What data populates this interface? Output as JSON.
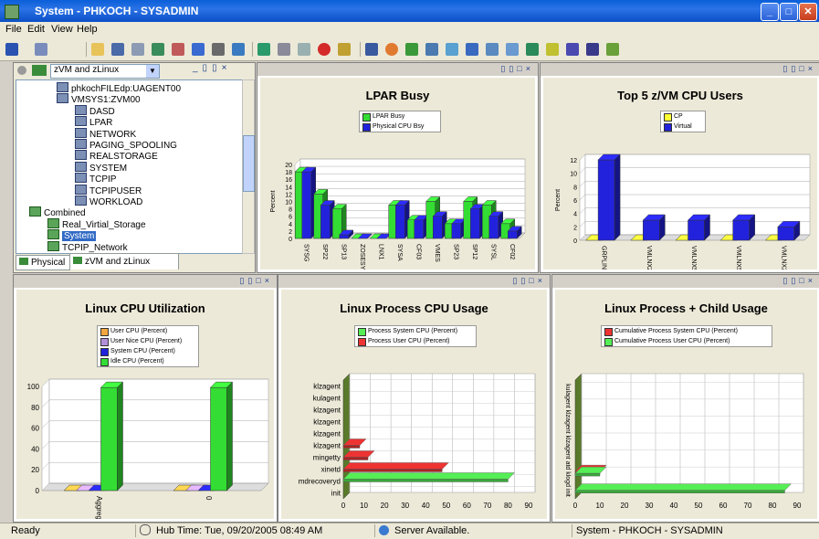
{
  "window": {
    "title": "System - PHKOCH - SYSADMIN",
    "colors": {
      "titlebar": "#0a5fd8",
      "panel_bg": "#ece9d8",
      "green": "#33dd33",
      "blue": "#2222dd",
      "red": "#ee3333",
      "orange": "#f4a640",
      "purple": "#b28fd8",
      "yellow": "#ffff33",
      "light_green": "#55ee55"
    }
  },
  "menu": [
    "File",
    "Edit",
    "View",
    "Help"
  ],
  "navigator": {
    "view_select": "zVM and zLinux",
    "tree": [
      {
        "label": "phkochFILEdp:UAGENT00",
        "level": 4,
        "icon": "node-icon"
      },
      {
        "label": "VMSYS1:ZVM00",
        "level": 4,
        "icon": "node-icon"
      },
      {
        "label": "DASD",
        "level": 6,
        "icon": "workspace-icon"
      },
      {
        "label": "LPAR",
        "level": 6,
        "icon": "workspace-icon"
      },
      {
        "label": "NETWORK",
        "level": 6,
        "icon": "workspace-icon"
      },
      {
        "label": "PAGING_SPOOLING",
        "level": 6,
        "icon": "workspace-icon"
      },
      {
        "label": "REALSTORAGE",
        "level": 6,
        "icon": "workspace-icon"
      },
      {
        "label": "SYSTEM",
        "level": 6,
        "icon": "workspace-icon"
      },
      {
        "label": "TCPIP",
        "level": 6,
        "icon": "workspace-icon"
      },
      {
        "label": "TCPIPUSER",
        "level": 6,
        "icon": "workspace-icon"
      },
      {
        "label": "WORKLOAD",
        "level": 6,
        "icon": "workspace-icon"
      },
      {
        "label": "Combined",
        "level": 1,
        "icon": "combined-icon"
      },
      {
        "label": "Real_Virtial_Storage",
        "level": 3,
        "icon": "combined-icon"
      },
      {
        "label": "System",
        "level": 3,
        "icon": "combined-icon",
        "selected": true
      },
      {
        "label": "TCPIP_Network",
        "level": 3,
        "icon": "combined-icon"
      }
    ],
    "tabs": [
      "Physical",
      "zVM and zLinux"
    ]
  },
  "charts": {
    "lpar": {
      "title": "LPAR Busy",
      "ylabel": "Percent",
      "yticks": [
        "0",
        "2",
        "4",
        "6",
        "8",
        "10",
        "12",
        "14",
        "16",
        "18",
        "20"
      ],
      "ymax": 20,
      "legend": [
        "LPAR Busy",
        "Physical CPU Bsy"
      ],
      "categories": [
        "SYSG",
        "SP22",
        "SP13",
        "ZOSESYSE",
        "LNX1",
        "SYSA",
        "CF03",
        "VMES",
        "SP23",
        "SP12",
        "SYSL",
        "CF02"
      ]
    },
    "zvm": {
      "title": "Top 5 z/VM CPU Users",
      "ylabel": "Percent",
      "yticks": [
        "0",
        "2",
        "4",
        "6",
        "8",
        "10",
        "12"
      ],
      "ymax": 12,
      "legend": [
        "CP",
        "Virtual"
      ],
      "categories": [
        "GRPLINUX",
        "VMLNX2",
        "VMLNX51",
        "VMLNX5",
        "VMLNX21"
      ]
    },
    "cpu": {
      "title": "Linux CPU Utilization",
      "yticks": [
        "0",
        "20",
        "40",
        "60",
        "80",
        "100"
      ],
      "ymax": 100,
      "legend": [
        "User CPU (Percent)",
        "User Nice CPU (Percent)",
        "System CPU (Percent)",
        "Idle CPU (Percent)"
      ],
      "categories": [
        "Aggregate",
        "0"
      ]
    },
    "proc": {
      "title": "Linux Process CPU Usage",
      "xticks": [
        "0",
        "10",
        "20",
        "30",
        "40",
        "50",
        "60",
        "70",
        "80",
        "90"
      ],
      "xmax": 90,
      "legend": [
        "Process System CPU (Percent)",
        "Process User CPU (Percent)"
      ],
      "categories": [
        "klzagent",
        "kulagent",
        "klzagent",
        "klzagent",
        "klzagent",
        "klzagent",
        "mingetty",
        "xinetd",
        "mdrecoveryd",
        "init"
      ]
    },
    "child": {
      "title": "Linux Process + Child Usage",
      "xticks": [
        "0",
        "10",
        "20",
        "30",
        "40",
        "50",
        "60",
        "70",
        "80",
        "90"
      ],
      "xmax": 90,
      "legend": [
        "Cumulative Process System CPU (Percent)",
        "Cumulative Process User CPU (Percent)"
      ],
      "ylabel": "kulagent klzagent klzagent atd klogd init"
    }
  },
  "chart_data": [
    {
      "type": "bar",
      "title": "LPAR Busy",
      "ylabel": "Percent",
      "ylim": [
        0,
        20
      ],
      "categories": [
        "SYSG",
        "SP22",
        "SP13",
        "ZOSESYSE",
        "LNX1",
        "SYSA",
        "CF03",
        "VMES",
        "SP23",
        "SP12",
        "SYSL",
        "CF02"
      ],
      "series": [
        {
          "name": "LPAR Busy",
          "values": [
            18,
            12,
            8,
            0,
            0,
            9,
            5,
            10,
            4,
            10,
            9,
            4
          ]
        },
        {
          "name": "Physical CPU Bsy",
          "values": [
            18,
            9,
            1,
            0,
            0,
            9,
            5,
            6,
            4,
            8,
            6,
            2
          ]
        }
      ]
    },
    {
      "type": "bar",
      "title": "Top 5 z/VM CPU Users",
      "ylabel": "Percent",
      "ylim": [
        0,
        12
      ],
      "categories": [
        "GRPLINUX",
        "VMLNX2",
        "VMLNX51",
        "VMLNX5",
        "VMLNX21"
      ],
      "series": [
        {
          "name": "CP",
          "values": [
            0,
            0,
            0,
            0,
            0
          ]
        },
        {
          "name": "Virtual",
          "values": [
            12,
            3,
            3,
            3,
            2
          ]
        }
      ]
    },
    {
      "type": "bar",
      "title": "Linux CPU Utilization",
      "ylim": [
        0,
        100
      ],
      "categories": [
        "Aggregate",
        "0"
      ],
      "series": [
        {
          "name": "User CPU (Percent)",
          "values": [
            0,
            0
          ]
        },
        {
          "name": "User Nice CPU (Percent)",
          "values": [
            0,
            0
          ]
        },
        {
          "name": "System CPU (Percent)",
          "values": [
            0,
            0
          ]
        },
        {
          "name": "Idle CPU (Percent)",
          "values": [
            99,
            99
          ]
        }
      ]
    },
    {
      "type": "bar",
      "title": "Linux Process CPU Usage",
      "xlim": [
        0,
        90
      ],
      "categories": [
        "klzagent",
        "kulagent",
        "klzagent",
        "klzagent",
        "klzagent",
        "klzagent",
        "mingetty",
        "xinetd",
        "mdrecoveryd",
        "init"
      ],
      "series": [
        {
          "name": "Process System CPU (Percent)",
          "values": [
            0,
            0,
            0,
            0,
            0,
            0,
            0,
            0,
            80,
            0
          ]
        },
        {
          "name": "Process User CPU (Percent)",
          "values": [
            0,
            0,
            0,
            0,
            0,
            8,
            12,
            48,
            0,
            0
          ]
        }
      ]
    },
    {
      "type": "bar",
      "title": "Linux Process + Child Usage",
      "xlim": [
        0,
        90
      ],
      "series": [
        {
          "name": "Cumulative Process System CPU (Percent)",
          "values": [
            0,
            0,
            0,
            0,
            0,
            10,
            0
          ]
        },
        {
          "name": "Cumulative Process User CPU (Percent)",
          "values": [
            0,
            0,
            0,
            0,
            0,
            10,
            85
          ]
        }
      ]
    }
  ],
  "status": {
    "ready": "Ready",
    "hub_time": "Hub Time: Tue, 09/20/2005 08:49 AM",
    "server": "Server Available.",
    "context": "System - PHKOCH - SYSADMIN"
  }
}
